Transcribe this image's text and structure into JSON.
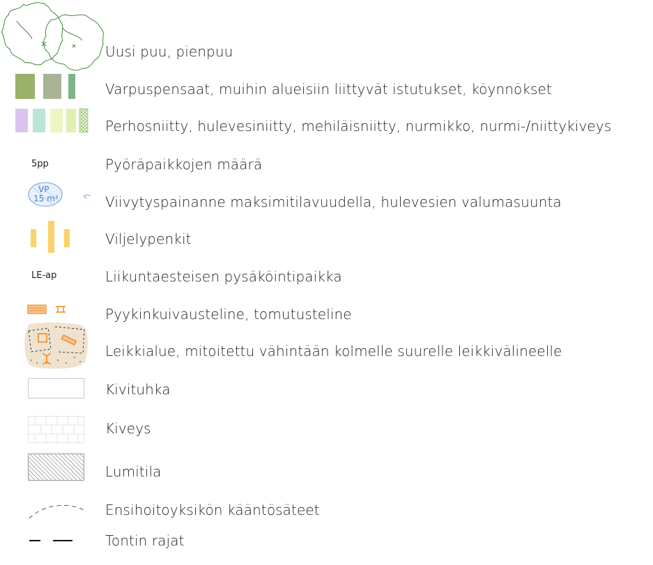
{
  "legend": [
    {
      "symbol": "tree-icon",
      "label": "Uusi puu, pienpuu"
    },
    {
      "symbol": "shrub-swatches-icon",
      "label": "Varpuspensaat, muihin alueisiin liittyvät istutukset, köynnökset",
      "colors": [
        "#9bb06a",
        "#a8b495",
        "#7fb38c"
      ]
    },
    {
      "symbol": "meadow-swatches-icon",
      "label": "Perhosniitty, hulevesiniitty, mehiläisniitty, nurmikko, nurmi-/niittykiveys",
      "colors": [
        "#dcc3ee",
        "#b9e6d6",
        "#edf6c4",
        "#dff0b2",
        "#b9d98a"
      ]
    },
    {
      "symbol": "bike-count-icon",
      "label": "Pyöräpaikkojen määrä",
      "symbol_text": "5pp"
    },
    {
      "symbol": "retention-basin-icon",
      "label": "Viivytyspainanne maksimitilavuudella, hulevesien valumasuunta",
      "symbol_text_1": "VP",
      "symbol_text_2": "15 m³"
    },
    {
      "symbol": "planter-boxes-icon",
      "label": "Viljelypenkit",
      "colors": [
        "#f8d46a"
      ]
    },
    {
      "symbol": "accessible-parking-icon",
      "label": "Liikuntaesteisen pysäköintipaikka",
      "symbol_text": "LE-ap"
    },
    {
      "symbol": "drying-rack-icon",
      "label": "Pyykinkuivausteline, tomutusteline",
      "colors": [
        "#f08a24"
      ]
    },
    {
      "symbol": "playground-icon",
      "label": "Leikkialue, mitoitettu vähintään kolmelle suurelle leikkivälineelle",
      "colors": [
        "#efe3cf",
        "#f08a24"
      ]
    },
    {
      "symbol": "gravel-icon",
      "label": "Kivituhka"
    },
    {
      "symbol": "paving-icon",
      "label": "Kiveys"
    },
    {
      "symbol": "snow-storage-icon",
      "label": "Lumitila"
    },
    {
      "symbol": "turning-radius-icon",
      "label": "Ensihoitoyksikön kääntösäteet"
    },
    {
      "symbol": "plot-boundary-icon",
      "label": "Tontin rajat"
    }
  ]
}
